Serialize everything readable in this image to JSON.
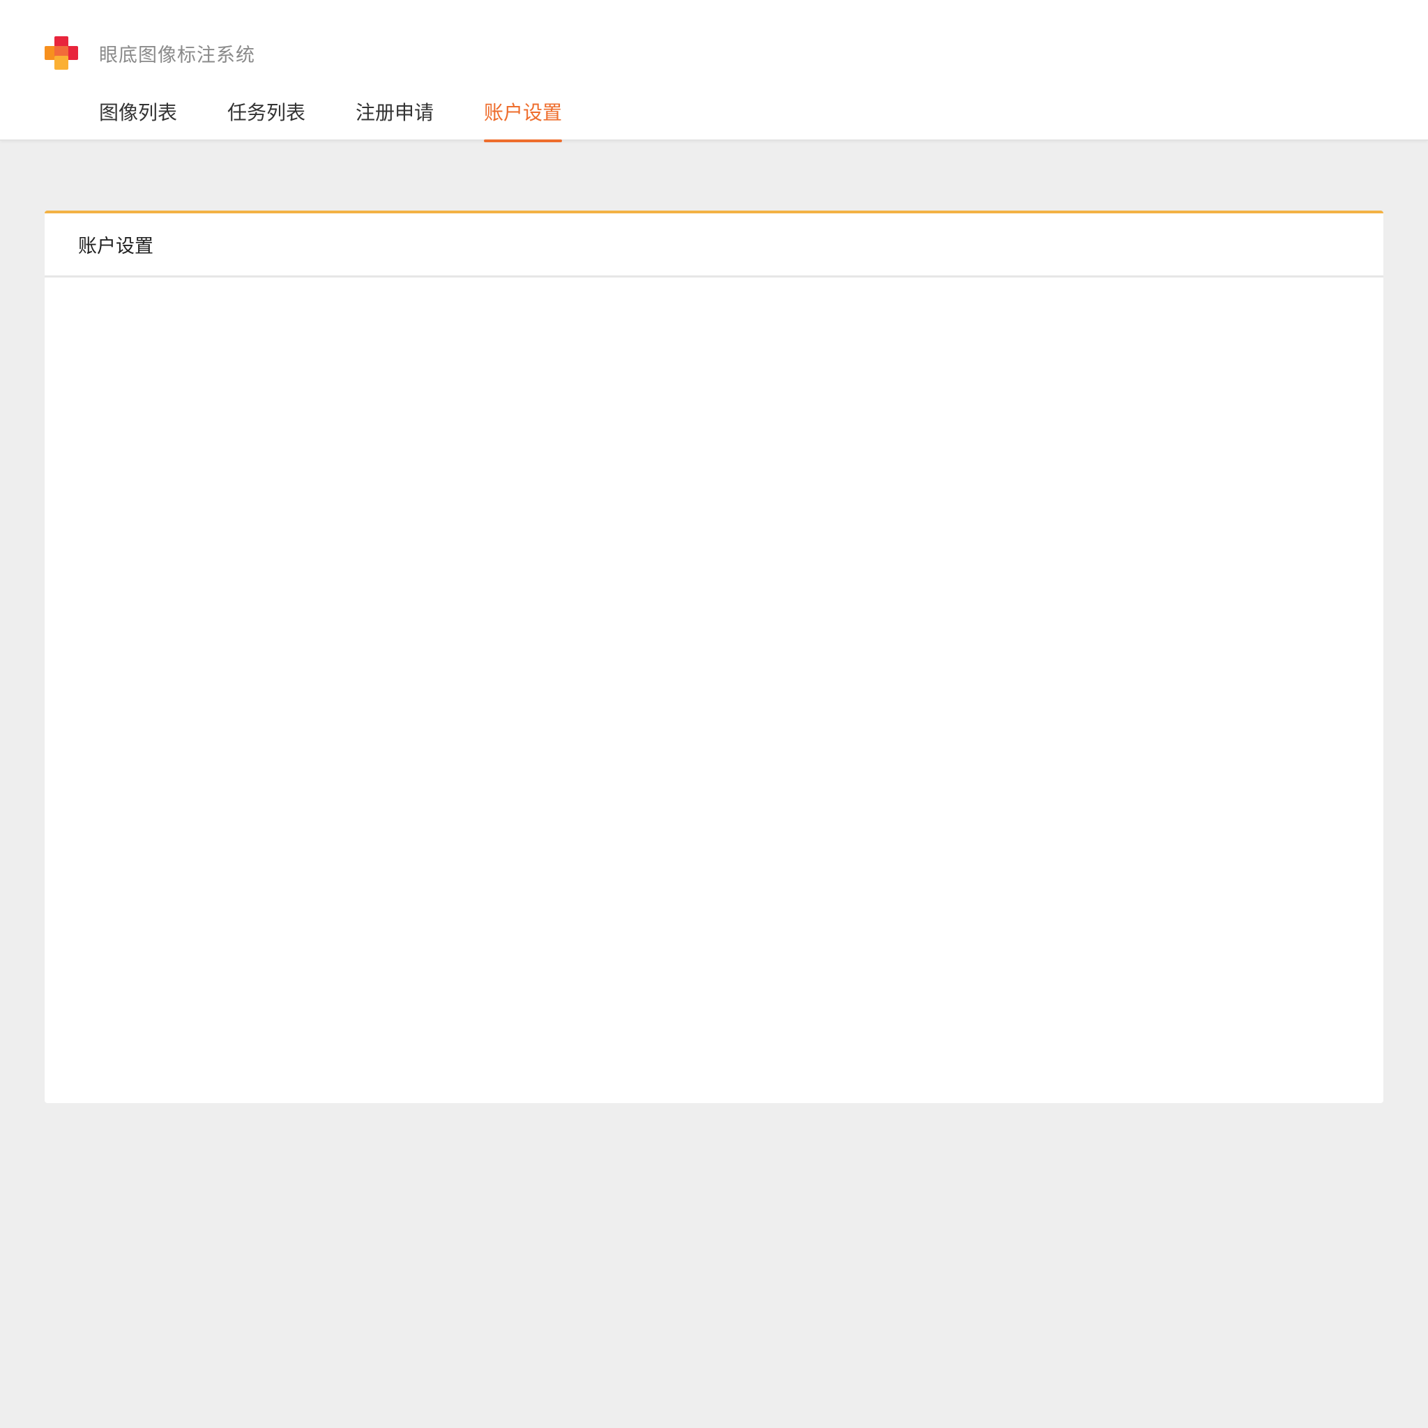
{
  "app": {
    "title": "眼底图像标注系统",
    "logo": "orange-red-cross-logo-icon"
  },
  "nav": {
    "tabs": [
      {
        "label": "图像列表",
        "active": false
      },
      {
        "label": "任务列表",
        "active": false
      },
      {
        "label": "注册申请",
        "active": false
      },
      {
        "label": "账户设置",
        "active": true
      }
    ]
  },
  "card": {
    "title": "账户设置"
  },
  "colors": {
    "accent": "#ee6d2c",
    "card_top_border": "#f3b245",
    "logo_red": "#e8253c",
    "logo_orange": "#f7901e",
    "logo_yellow": "#fbb034",
    "background": "#eeeeee"
  }
}
